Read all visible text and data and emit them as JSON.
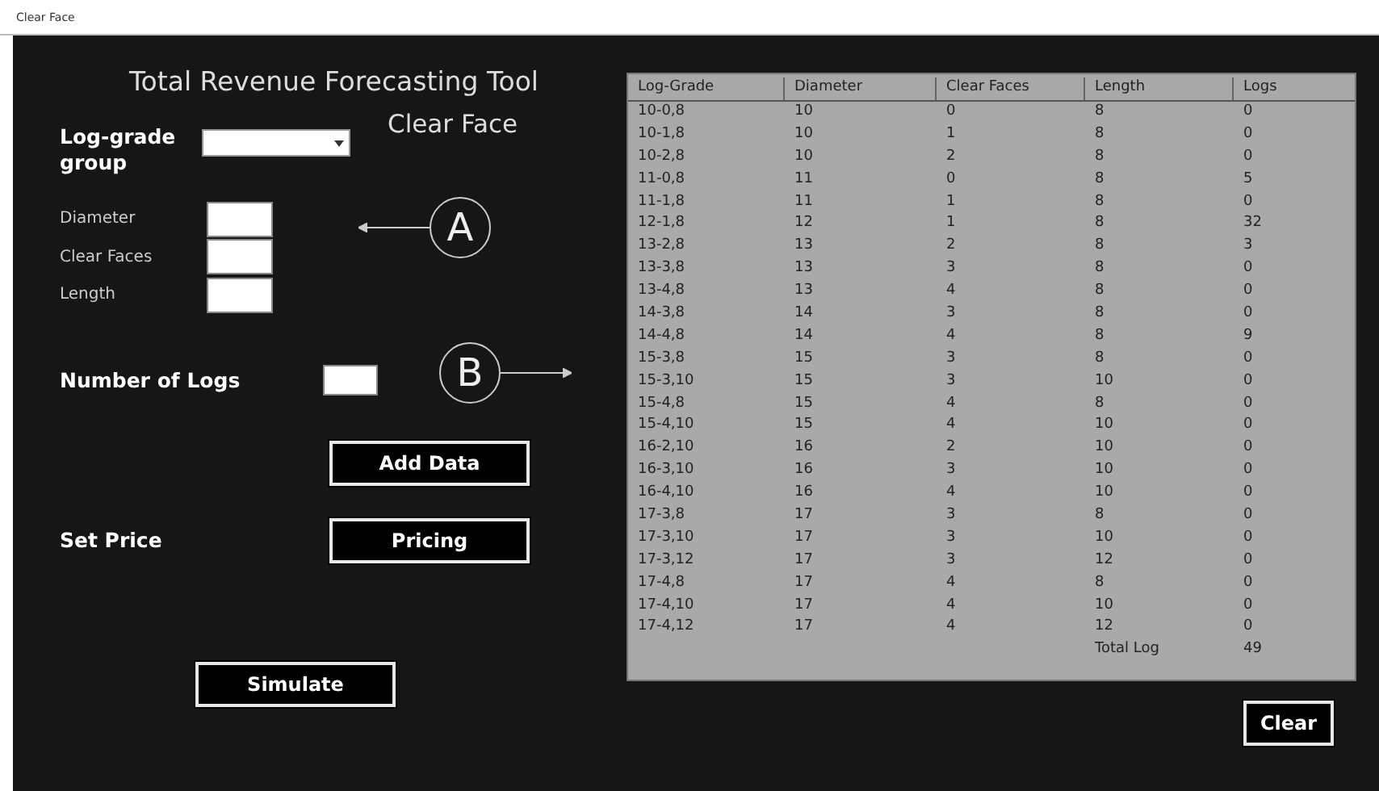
{
  "window": {
    "title": "Clear Face"
  },
  "form": {
    "heading": "Total Revenue Forecasting Tool",
    "subheading": "Clear Face",
    "log_grade_label": "Log-grade group",
    "fields": [
      {
        "label": "Diameter"
      },
      {
        "label": "Clear Faces"
      },
      {
        "label": "Length"
      }
    ],
    "number_of_logs_label": "Number of Logs",
    "add_button": "Add Data",
    "set_price_label": "Set Price",
    "pricing_button": "Pricing",
    "simulate_button": "Simulate"
  },
  "annotations": [
    {
      "label": "A",
      "kind": "left"
    },
    {
      "label": "B",
      "kind": "right"
    }
  ],
  "table": {
    "columns": [
      "Log-Grade",
      "Diameter",
      "Clear Faces",
      "Length",
      "Logs"
    ],
    "rows": [
      [
        "10-0,8",
        "10",
        "0",
        "8",
        "0"
      ],
      [
        "10-1,8",
        "10",
        "1",
        "8",
        "0"
      ],
      [
        "10-2,8",
        "10",
        "2",
        "8",
        "0"
      ],
      [
        "11-0,8",
        "11",
        "0",
        "8",
        "5"
      ],
      [
        "11-1,8",
        "11",
        "1",
        "8",
        "0"
      ],
      [
        "12-1,8",
        "12",
        "1",
        "8",
        "32"
      ],
      [
        "13-2,8",
        "13",
        "2",
        "8",
        "3"
      ],
      [
        "13-3,8",
        "13",
        "3",
        "8",
        "0"
      ],
      [
        "13-4,8",
        "13",
        "4",
        "8",
        "0"
      ],
      [
        "14-3,8",
        "14",
        "3",
        "8",
        "0"
      ],
      [
        "14-4,8",
        "14",
        "4",
        "8",
        "9"
      ],
      [
        "15-3,8",
        "15",
        "3",
        "8",
        "0"
      ],
      [
        "15-3,10",
        "15",
        "3",
        "10",
        "0"
      ],
      [
        "15-4,8",
        "15",
        "4",
        "8",
        "0"
      ],
      [
        "15-4,10",
        "15",
        "4",
        "10",
        "0"
      ],
      [
        "16-2,10",
        "16",
        "2",
        "10",
        "0"
      ],
      [
        "16-3,10",
        "16",
        "3",
        "10",
        "0"
      ],
      [
        "16-4,10",
        "16",
        "4",
        "10",
        "0"
      ],
      [
        "17-3,8",
        "17",
        "3",
        "8",
        "0"
      ],
      [
        "17-3,10",
        "17",
        "3",
        "10",
        "0"
      ],
      [
        "17-3,12",
        "17",
        "3",
        "12",
        "0"
      ],
      [
        "17-4,8",
        "17",
        "4",
        "8",
        "0"
      ],
      [
        "17-4,10",
        "17",
        "4",
        "10",
        "0"
      ],
      [
        "17-4,12",
        "17",
        "4",
        "12",
        "0"
      ]
    ],
    "total": {
      "label": "Total Log",
      "value": "49"
    }
  },
  "clear_button": "Clear"
}
